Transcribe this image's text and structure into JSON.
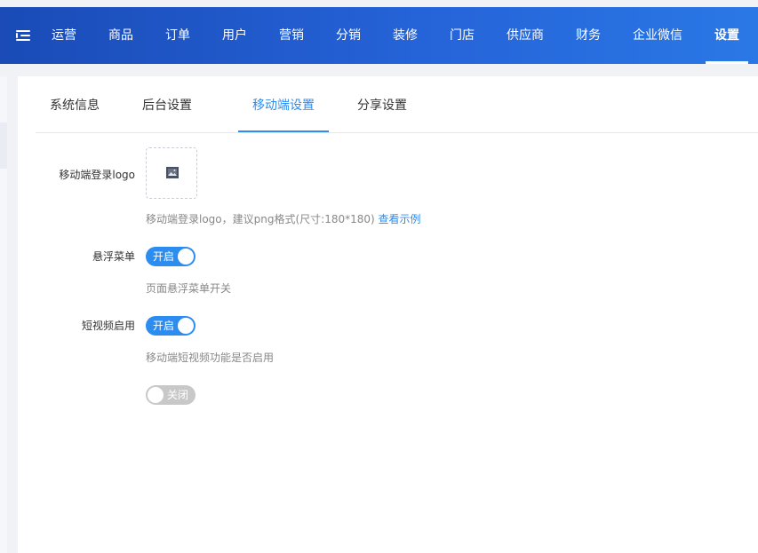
{
  "nav": {
    "items": [
      "运营",
      "商品",
      "订单",
      "用户",
      "营销",
      "分销",
      "装修",
      "门店",
      "供应商",
      "财务",
      "企业微信",
      "设置"
    ],
    "active": "设置"
  },
  "tabs": {
    "items": [
      "系统信息",
      "后台设置",
      "移动端设置",
      "分享设置"
    ],
    "active": "移动端设置"
  },
  "form": {
    "logo": {
      "label": "移动端登录logo",
      "help": "移动端登录logo，建议png格式(尺寸:180*180)",
      "link": "查看示例"
    },
    "float_menu": {
      "label": "悬浮菜单",
      "switch_text": "开启",
      "help": "页面悬浮菜单开关"
    },
    "short_video": {
      "label": "短视频启用",
      "switch_text": "开启",
      "help": "移动端短视频功能是否启用"
    },
    "extra_switch": {
      "switch_text": "关闭"
    }
  },
  "colors": {
    "nav_start": "#1a4bb7",
    "nav_end": "#2a78e6",
    "accent": "#2d8cf0",
    "switch_off": "#c8c8c8"
  }
}
